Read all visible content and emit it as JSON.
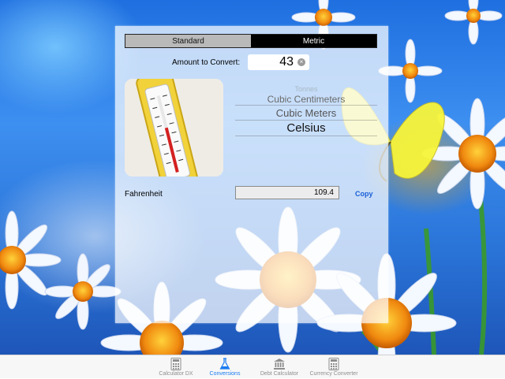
{
  "segments": {
    "standard_label": "Standard",
    "metric_label": "Metric",
    "selected": "Metric"
  },
  "amount": {
    "label": "Amount to Convert:",
    "value": "43",
    "clear_icon": "clear-circle-icon"
  },
  "picker": {
    "items": [
      "Tonnes",
      "Cubic Centimeters",
      "Cubic Meters",
      "Celsius"
    ],
    "selected": "Celsius"
  },
  "result": {
    "label": "Fahrenheit",
    "value": "109.4",
    "copy_label": "Copy"
  },
  "tabs": [
    {
      "label": "Calculator DX",
      "icon": "calculator-icon",
      "active": false
    },
    {
      "label": "Conversions",
      "icon": "flask-icon",
      "active": true
    },
    {
      "label": "Debt Calculator",
      "icon": "bank-icon",
      "active": false
    },
    {
      "label": "Currency Converter",
      "icon": "calculator-icon",
      "active": false
    }
  ],
  "colors": {
    "active_tab": "#1a7cf0",
    "inactive_tab": "#8e8e8e",
    "segment_selected": "#000000"
  }
}
